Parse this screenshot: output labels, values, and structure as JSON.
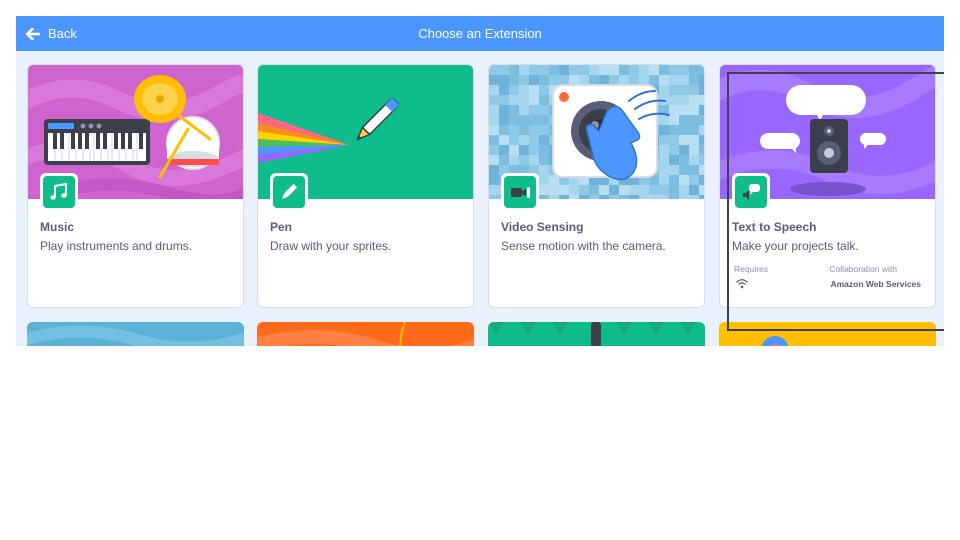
{
  "header": {
    "back_label": "Back",
    "title": "Choose an Extension"
  },
  "extensions": [
    {
      "name": "Music",
      "description": "Play instruments and drums.",
      "color": "#cf63cf",
      "icon": "music-notes-icon"
    },
    {
      "name": "Pen",
      "description": "Draw with your sprites.",
      "color": "#0fbd8c",
      "icon": "pen-icon"
    },
    {
      "name": "Video Sensing",
      "description": "Sense motion with the camera.",
      "color": "#8fc9e8",
      "icon": "video-camera-icon"
    },
    {
      "name": "Text to Speech",
      "description": "Make your projects talk.",
      "color": "#9966ff",
      "icon": "speech-icon",
      "requires_label": "Requires",
      "requires_icon": "wifi-icon",
      "collaboration_label": "Collaboration with",
      "collaboration_value": "Amazon Web Services"
    }
  ],
  "colors": {
    "header": "#4c97ff",
    "modal_background": "#e9f1fc",
    "badge": "#0fbd8c",
    "text": "#575e75"
  }
}
